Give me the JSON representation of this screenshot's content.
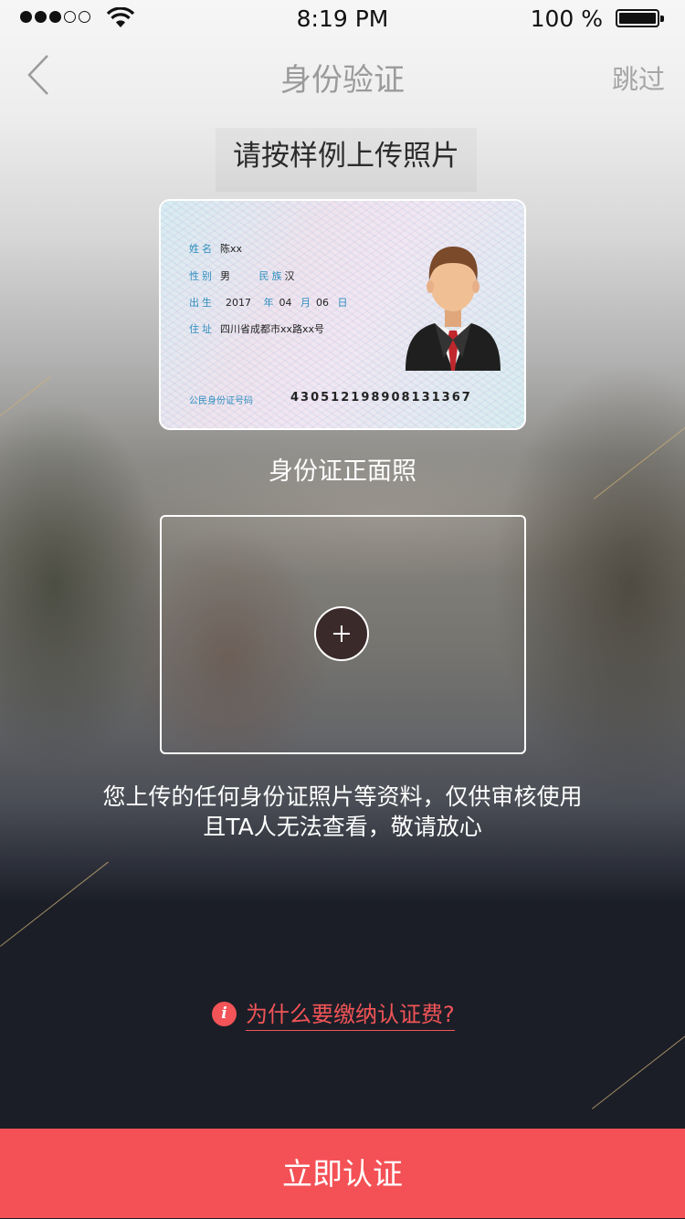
{
  "status_bar": {
    "time": "8:19 PM",
    "battery_percent": "100 %",
    "signal_bars_filled": 3,
    "signal_bars_total": 5
  },
  "nav": {
    "title": "身份验证",
    "skip_label": "跳过"
  },
  "sample_tip": "请按样例上传照片",
  "id_card": {
    "name_label": "姓名",
    "name_value": "陈xx",
    "gender_label": "性别",
    "gender_value": "男",
    "ethnicity_label": "民族",
    "ethnicity_value": "汉",
    "birth_label": "出生",
    "birth_year": "2017",
    "year_unit": "年",
    "birth_month": "04",
    "month_unit": "月",
    "birth_day": "06",
    "day_unit": "日",
    "address_label": "住址",
    "address_value": "四川省成都市xx路xx号",
    "id_number_label": "公民身份证号码",
    "id_number": "430512198908131367"
  },
  "front_caption": "身份证正面照",
  "notice": {
    "line1": "您上传的任何身份证照片等资料，仅供审核使用",
    "line2": "且TA人无法查看，敬请放心"
  },
  "fee_link": {
    "icon": "info-icon",
    "label": "为什么要缴纳认证费?"
  },
  "verify_button": {
    "label": "立即认证"
  },
  "colors": {
    "accent": "#f45156",
    "dark_background": "#1b1e27",
    "card_label_blue": "#2f8ebf"
  }
}
